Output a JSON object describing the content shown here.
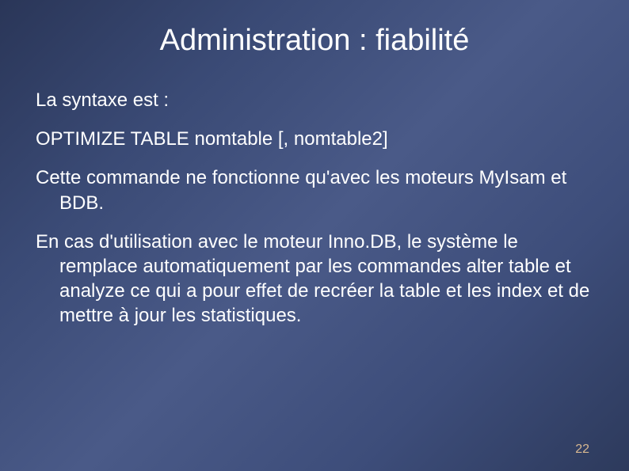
{
  "slide": {
    "title": "Administration : fiabilité",
    "paragraphs": {
      "p1": "La syntaxe est :",
      "p2": "OPTIMIZE TABLE nomtable [, nomtable2]",
      "p3": "Cette commande ne fonctionne qu'avec les moteurs MyIsam et BDB.",
      "p4": "En cas d'utilisation avec le moteur Inno.DB, le système le remplace automatiquement par les commandes alter table et analyze ce qui a pour effet de recréer la table et les index et de mettre à jour les statistiques."
    },
    "page_number": "22"
  }
}
